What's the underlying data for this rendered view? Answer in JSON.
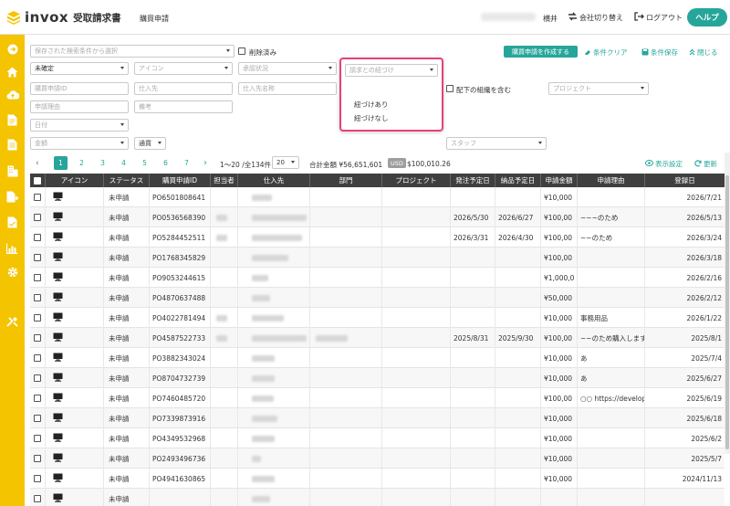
{
  "header": {
    "logo_word": "invox",
    "logo_sub": "受取請求書",
    "page_title": "購買申請",
    "user_name": "横井",
    "company_switch": "会社切り替え",
    "logout": "ログアウト",
    "help": "ヘルプ"
  },
  "sidebar": {
    "icons": [
      "arrow-right-circle-icon",
      "home-icon",
      "cloud-upload-icon",
      "document-icon",
      "document-list-icon",
      "building-icon",
      "document-export-icon",
      "document-check-icon",
      "bar-chart-icon",
      "gear-icon",
      "tools-icon"
    ]
  },
  "filters": {
    "saved_search_placeholder": "保存された検索条件から選択",
    "deleted_label": "削除済み",
    "status": "未確定",
    "icon_placeholder": "アイコン",
    "approval_placeholder": "承認状況",
    "invoice_link_placeholder": "請求との紐づけ",
    "request_id_placeholder": "購買申請ID",
    "vendor_placeholder": "仕入先",
    "vendor_name_placeholder": "仕入先名称",
    "include_sub_org_label": "配下の組織を含む",
    "project_placeholder": "プロジェクト",
    "reason_placeholder": "申請理由",
    "note_placeholder": "備考",
    "date_placeholder": "日付",
    "amount_placeholder": "金額",
    "currency": "通貨",
    "staff_placeholder": "スタッフ"
  },
  "actions": {
    "create_label": "購買申請を作成する",
    "clear_label": "条件クリア",
    "save_label": "条件保存",
    "close_label": "閉じる",
    "display_settings": "表示設定",
    "refresh": "更新"
  },
  "dropdown": {
    "placeholder": "請求との紐づけ",
    "options": [
      "紐づけあり",
      "紐づけなし"
    ]
  },
  "pagination": {
    "pages": [
      "1",
      "2",
      "3",
      "4",
      "5",
      "6",
      "7"
    ],
    "active": "1",
    "range": "1〜20 /全134件",
    "per_page": "20",
    "total_label": "合計金額 ¥56,651,601",
    "usd_badge": "USD",
    "usd_total": "$100,010.26"
  },
  "table": {
    "columns": [
      "アイコン",
      "ステータス",
      "購買申請ID",
      "担当者",
      "仕入先",
      "部門",
      "プロジェクト",
      "発注予定日",
      "納品予定日",
      "申請金額",
      "申請理由",
      "登録日"
    ],
    "rows": [
      {
        "status": "未申請",
        "id": "PO6501808641",
        "order": "",
        "delivery": "",
        "amount": "¥10,000",
        "reason": "",
        "registered": "2026/7/21"
      },
      {
        "status": "未申請",
        "id": "PO0536568390",
        "order": "2026/5/30",
        "delivery": "2026/6/27",
        "amount": "¥100,00",
        "reason": "~~~のため",
        "registered": "2026/5/13"
      },
      {
        "status": "未申請",
        "id": "PO5284452511",
        "order": "2026/3/31",
        "delivery": "2026/4/30",
        "amount": "¥100,00",
        "reason": "~~のため",
        "registered": "2026/3/24"
      },
      {
        "status": "未申請",
        "id": "PO1768345829",
        "order": "",
        "delivery": "",
        "amount": "¥100,00",
        "reason": "",
        "registered": "2026/3/18"
      },
      {
        "status": "未申請",
        "id": "PO9053244615",
        "order": "",
        "delivery": "",
        "amount": "¥1,000,0",
        "reason": "",
        "registered": "2026/2/16"
      },
      {
        "status": "未申請",
        "id": "PO4870637488",
        "order": "",
        "delivery": "",
        "amount": "¥50,000",
        "reason": "",
        "registered": "2026/2/12"
      },
      {
        "status": "未申請",
        "id": "PO4022781494",
        "order": "",
        "delivery": "",
        "amount": "¥10,000",
        "reason": "事務用品",
        "registered": "2026/1/22"
      },
      {
        "status": "未申請",
        "id": "PO4587522733",
        "order": "2025/8/31",
        "delivery": "2025/9/30",
        "amount": "¥100,00",
        "reason": "~~のため購入します",
        "registered": "2025/8/1"
      },
      {
        "status": "未申請",
        "id": "PO3882343024",
        "order": "",
        "delivery": "",
        "amount": "¥10,000",
        "reason": "あ",
        "registered": "2025/7/4"
      },
      {
        "status": "未申請",
        "id": "PO8704732739",
        "order": "",
        "delivery": "",
        "amount": "¥10,000",
        "reason": "あ",
        "registered": "2025/6/27"
      },
      {
        "status": "未申請",
        "id": "PO7460485720",
        "order": "",
        "delivery": "",
        "amount": "¥100,00",
        "reason": "○○ https://developr",
        "registered": "2025/6/19"
      },
      {
        "status": "未申請",
        "id": "PO7339873916",
        "order": "",
        "delivery": "",
        "amount": "¥10,000",
        "reason": "",
        "registered": "2025/6/18"
      },
      {
        "status": "未申請",
        "id": "PO4349532968",
        "order": "",
        "delivery": "",
        "amount": "¥10,000",
        "reason": "",
        "registered": "2025/6/2"
      },
      {
        "status": "未申請",
        "id": "PO2493496736",
        "order": "",
        "delivery": "",
        "amount": "¥10,000",
        "reason": "",
        "registered": "2025/5/7"
      },
      {
        "status": "未申請",
        "id": "PO4941630865",
        "order": "",
        "delivery": "",
        "amount": "¥10,000",
        "reason": "",
        "registered": "2024/11/13"
      },
      {
        "status": "未申請",
        "id": "",
        "order": "",
        "delivery": "",
        "amount": "",
        "reason": "",
        "registered": ""
      }
    ]
  },
  "colors": {
    "accent": "#26a69a",
    "sidebar": "#f5c400",
    "highlight": "#e8407a",
    "table_header": "#3f3f3f"
  }
}
